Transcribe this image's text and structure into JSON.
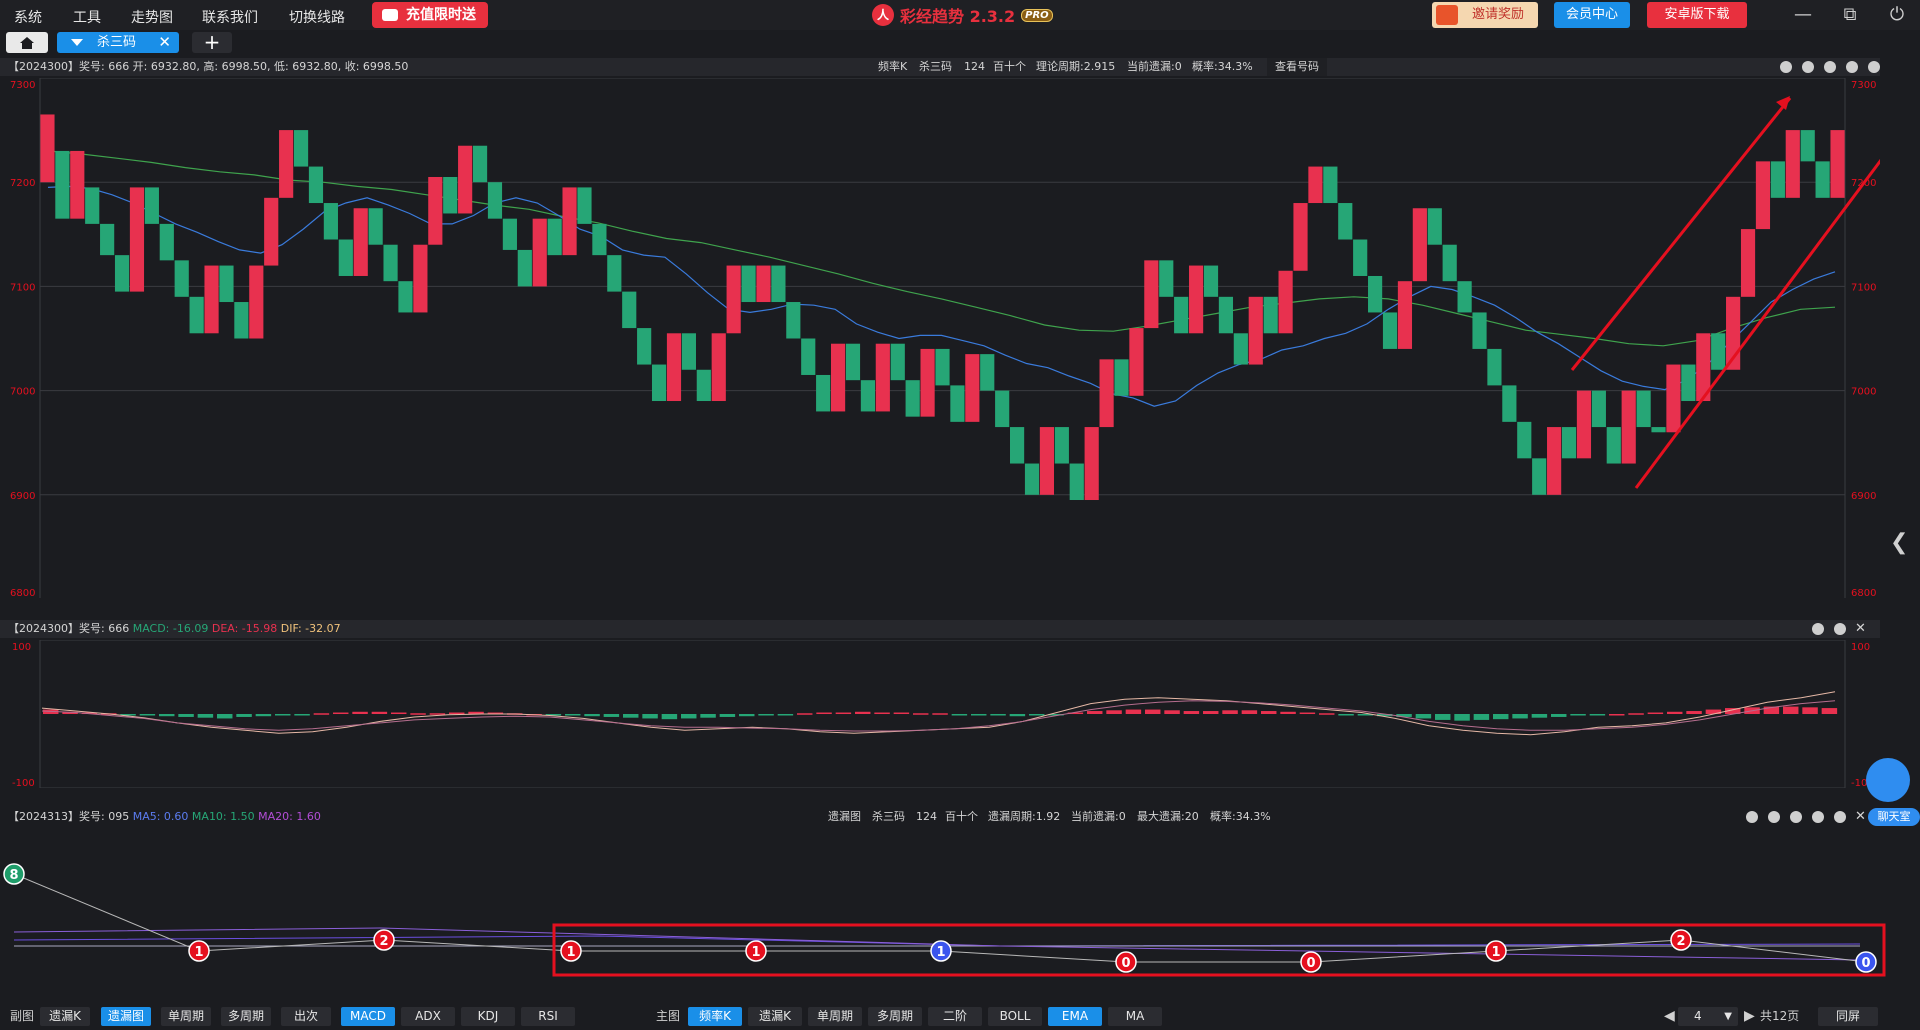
{
  "menu": [
    "系统",
    "工具",
    "走势图",
    "联系我们",
    "切换线路"
  ],
  "promo_label": "充值限时送",
  "app": {
    "logo_glyph": "人",
    "name": "彩经趋势 2.3.2",
    "badge": "PRO"
  },
  "top_buttons": {
    "invite": "邀请奖励",
    "member": "会员中心",
    "android": "安卓版下载"
  },
  "window_controls": {
    "minimize": "—",
    "restore": "⧉",
    "power": "⏻"
  },
  "tabs": {
    "active": "杀三码",
    "add": "+",
    "close": "✕"
  },
  "main_panel": {
    "info": "【2024300】奖号: 666  开: 6932.80, 高: 6998.50, 低: 6932.80, 收: 6998.50",
    "stats": [
      "频率K",
      "杀三码",
      "124",
      "百十个",
      "理论周期:2.915",
      "当前遗漏:0",
      "概率:34.3%"
    ],
    "link": "查看号码",
    "y_ticks": [
      "7300",
      "7200",
      "7100",
      "7000",
      "6900",
      "6800"
    ]
  },
  "macd_panel": {
    "prefix": "【2024300】奖号: 666",
    "macd": "MACD: -16.09",
    "dea": "DEA: -15.98",
    "dif": "DIF: -32.07",
    "y_ticks": [
      "100",
      "-100"
    ]
  },
  "miss_panel": {
    "prefix": "【2024313】奖号: 095",
    "ma5": "MA5: 0.60",
    "ma10": "MA10: 1.50",
    "ma20": "MA20: 1.60",
    "stats": [
      "遗漏图",
      "杀三码",
      "124",
      "百十个",
      "遗漏周期:1.92",
      "当前遗漏:0",
      "最大遗漏:20",
      "概率:34.3%"
    ]
  },
  "miss_points": [
    {
      "v": 8,
      "color": "#1f9d6a"
    },
    {
      "v": 1,
      "color": "#e5101f"
    },
    {
      "v": 2,
      "color": "#e5101f"
    },
    {
      "v": 1,
      "color": "#e5101f"
    },
    {
      "v": 1,
      "color": "#e5101f"
    },
    {
      "v": 1,
      "color": "#3b55ee"
    },
    {
      "v": 0,
      "color": "#e5101f"
    },
    {
      "v": 0,
      "color": "#e5101f"
    },
    {
      "v": 1,
      "color": "#e5101f"
    },
    {
      "v": 2,
      "color": "#e5101f"
    },
    {
      "v": 0,
      "color": "#3b55ee"
    }
  ],
  "bottom": {
    "sub_label": "副图",
    "sub_buttons": [
      "遗漏K",
      "遗漏图",
      "单周期",
      "多周期",
      "出次",
      "MACD",
      "ADX",
      "KDJ",
      "RSI"
    ],
    "main_label": "主图",
    "main_buttons": [
      "频率K",
      "遗漏K",
      "单周期",
      "多周期",
      "二阶",
      "BOLL",
      "EMA",
      "MA"
    ],
    "page_value": "4",
    "page_total": "共12页",
    "same_screen": "同屏"
  },
  "chat_label": "聊天室",
  "colors": {
    "up": "#e8314f",
    "down": "#26a676",
    "accent": "#1a8fe8",
    "ema_fast": "#3a7bdc",
    "ema_slow": "#3fa34d"
  },
  "chart_data": {
    "type": "candlestick",
    "ylim": [
      6800,
      7300
    ],
    "ohlc": [
      [
        7200,
        7265,
        7200,
        7265
      ],
      [
        7230,
        7230,
        7165,
        7165
      ],
      [
        7165,
        7230,
        7165,
        7230
      ],
      [
        7195,
        7195,
        7160,
        7160
      ],
      [
        7160,
        7160,
        7130,
        7130
      ],
      [
        7130,
        7130,
        7095,
        7095
      ],
      [
        7095,
        7195,
        7095,
        7195
      ],
      [
        7195,
        7195,
        7160,
        7160
      ],
      [
        7160,
        7160,
        7125,
        7125
      ],
      [
        7125,
        7125,
        7090,
        7090
      ],
      [
        7090,
        7090,
        7055,
        7055
      ],
      [
        7055,
        7120,
        7055,
        7120
      ],
      [
        7120,
        7120,
        7085,
        7085
      ],
      [
        7085,
        7085,
        7050,
        7050
      ],
      [
        7050,
        7120,
        7050,
        7120
      ],
      [
        7120,
        7185,
        7120,
        7185
      ],
      [
        7185,
        7250,
        7185,
        7250
      ],
      [
        7250,
        7250,
        7215,
        7215
      ],
      [
        7215,
        7215,
        7180,
        7180
      ],
      [
        7180,
        7180,
        7145,
        7145
      ],
      [
        7145,
        7145,
        7110,
        7110
      ],
      [
        7110,
        7175,
        7110,
        7175
      ],
      [
        7175,
        7175,
        7140,
        7140
      ],
      [
        7140,
        7140,
        7105,
        7105
      ],
      [
        7105,
        7105,
        7075,
        7075
      ],
      [
        7075,
        7140,
        7075,
        7140
      ],
      [
        7140,
        7205,
        7140,
        7205
      ],
      [
        7205,
        7205,
        7170,
        7170
      ],
      [
        7170,
        7235,
        7170,
        7235
      ],
      [
        7235,
        7235,
        7200,
        7200
      ],
      [
        7200,
        7200,
        7165,
        7165
      ],
      [
        7165,
        7165,
        7135,
        7135
      ],
      [
        7135,
        7135,
        7100,
        7100
      ],
      [
        7100,
        7165,
        7100,
        7165
      ],
      [
        7165,
        7165,
        7130,
        7130
      ],
      [
        7130,
        7195,
        7130,
        7195
      ],
      [
        7195,
        7195,
        7160,
        7160
      ],
      [
        7160,
        7160,
        7130,
        7130
      ],
      [
        7130,
        7130,
        7095,
        7095
      ],
      [
        7095,
        7095,
        7060,
        7060
      ],
      [
        7060,
        7060,
        7025,
        7025
      ],
      [
        7025,
        7025,
        6990,
        6990
      ],
      [
        6990,
        7055,
        6990,
        7055
      ],
      [
        7055,
        7055,
        7020,
        7020
      ],
      [
        7020,
        7020,
        6990,
        6990
      ],
      [
        6990,
        7055,
        6990,
        7055
      ],
      [
        7055,
        7120,
        7055,
        7120
      ],
      [
        7120,
        7120,
        7085,
        7085
      ],
      [
        7085,
        7120,
        7085,
        7120
      ],
      [
        7120,
        7120,
        7085,
        7085
      ],
      [
        7085,
        7085,
        7050,
        7050
      ],
      [
        7050,
        7050,
        7015,
        7015
      ],
      [
        7015,
        7015,
        6980,
        6980
      ],
      [
        6980,
        7045,
        6980,
        7045
      ],
      [
        7045,
        7045,
        7010,
        7010
      ],
      [
        7010,
        7010,
        6980,
        6980
      ],
      [
        6980,
        7045,
        6980,
        7045
      ],
      [
        7045,
        7045,
        7010,
        7010
      ],
      [
        7010,
        7010,
        6975,
        6975
      ],
      [
        6975,
        7040,
        6975,
        7040
      ],
      [
        7040,
        7040,
        7005,
        7005
      ],
      [
        7005,
        7005,
        6970,
        6970
      ],
      [
        6970,
        7035,
        6970,
        7035
      ],
      [
        7035,
        7035,
        7000,
        7000
      ],
      [
        7000,
        7000,
        6965,
        6965
      ],
      [
        6965,
        6965,
        6930,
        6930
      ],
      [
        6930,
        6930,
        6900,
        6900
      ],
      [
        6900,
        6965,
        6900,
        6965
      ],
      [
        6965,
        6965,
        6930,
        6930
      ],
      [
        6930,
        6930,
        6895,
        6895
      ],
      [
        6895,
        6965,
        6895,
        6965
      ],
      [
        6965,
        7030,
        6965,
        7030
      ],
      [
        7030,
        7030,
        6995,
        6995
      ],
      [
        6995,
        7060,
        6995,
        7060
      ],
      [
        7060,
        7125,
        7060,
        7125
      ],
      [
        7125,
        7125,
        7090,
        7090
      ],
      [
        7090,
        7090,
        7055,
        7055
      ],
      [
        7055,
        7120,
        7055,
        7120
      ],
      [
        7120,
        7120,
        7090,
        7090
      ],
      [
        7090,
        7090,
        7055,
        7055
      ],
      [
        7055,
        7055,
        7025,
        7025
      ],
      [
        7025,
        7090,
        7025,
        7090
      ],
      [
        7090,
        7090,
        7055,
        7055
      ],
      [
        7055,
        7115,
        7055,
        7115
      ],
      [
        7115,
        7180,
        7115,
        7180
      ],
      [
        7180,
        7215,
        7180,
        7215
      ],
      [
        7215,
        7215,
        7180,
        7180
      ],
      [
        7180,
        7180,
        7145,
        7145
      ],
      [
        7145,
        7145,
        7110,
        7110
      ],
      [
        7110,
        7110,
        7075,
        7075
      ],
      [
        7075,
        7075,
        7040,
        7040
      ],
      [
        7040,
        7105,
        7040,
        7105
      ],
      [
        7105,
        7175,
        7105,
        7175
      ],
      [
        7175,
        7175,
        7140,
        7140
      ],
      [
        7140,
        7140,
        7105,
        7105
      ],
      [
        7105,
        7105,
        7075,
        7075
      ],
      [
        7075,
        7075,
        7040,
        7040
      ],
      [
        7040,
        7040,
        7005,
        7005
      ],
      [
        7005,
        7005,
        6970,
        6970
      ],
      [
        6970,
        6970,
        6935,
        6935
      ],
      [
        6935,
        6935,
        6900,
        6900
      ],
      [
        6900,
        6965,
        6900,
        6965
      ],
      [
        6965,
        6965,
        6935,
        6935
      ],
      [
        6935,
        7000,
        6935,
        7000
      ],
      [
        7000,
        7000,
        6965,
        6965
      ],
      [
        6965,
        6965,
        6930,
        6930
      ],
      [
        6930,
        7000,
        6930,
        7000
      ],
      [
        7000,
        7000,
        6965,
        6965
      ],
      [
        6965,
        6965,
        6960,
        6960
      ],
      [
        6960,
        7025,
        6960,
        7025
      ],
      [
        7025,
        7025,
        6990,
        6990
      ],
      [
        6990,
        7055,
        6990,
        7055
      ],
      [
        7055,
        7055,
        7020,
        7020
      ],
      [
        7020,
        7090,
        7020,
        7090
      ],
      [
        7090,
        7155,
        7090,
        7155
      ],
      [
        7155,
        7220,
        7155,
        7220
      ],
      [
        7220,
        7220,
        7185,
        7185
      ],
      [
        7185,
        7250,
        7185,
        7250
      ],
      [
        7250,
        7250,
        7220,
        7220
      ],
      [
        7220,
        7220,
        7185,
        7185
      ],
      [
        7185,
        7250,
        7185,
        7250
      ]
    ],
    "ema_fast": [
      7195,
      7196,
      7194,
      7188,
      7180,
      7170,
      7160,
      7152,
      7143,
      7135,
      7132,
      7140,
      7155,
      7172,
      7180,
      7185,
      7178,
      7170,
      7160,
      7160,
      7168,
      7180,
      7185,
      7180,
      7168,
      7155,
      7148,
      7135,
      7130,
      7128,
      7112,
      7094,
      7078,
      7075,
      7078,
      7083,
      7082,
      7078,
      7064,
      7056,
      7050,
      7053,
      7053,
      7048,
      7043,
      7034,
      7026,
      7022,
      7014,
      7007,
      6997,
      6993,
      6985,
      6990,
      7005,
      7017,
      7025,
      7030,
      7039,
      7043,
      7050,
      7055,
      7064,
      7078,
      7090,
      7100,
      7097,
      7090,
      7082,
      7070,
      7056,
      7045,
      7032,
      7019,
      7009,
      7004,
      7001,
      7010,
      7025,
      7045,
      7065,
      7085,
      7097,
      7107,
      7114
    ],
    "ema_slow": [
      7230,
      7227,
      7223,
      7219,
      7214,
      7210,
      7207,
      7202,
      7200,
      7196,
      7193,
      7188,
      7183,
      7178,
      7174,
      7167,
      7161,
      7153,
      7146,
      7142,
      7135,
      7128,
      7120,
      7112,
      7103,
      7095,
      7088,
      7080,
      7072,
      7063,
      7058,
      7057,
      7062,
      7068,
      7074,
      7080,
      7084,
      7088,
      7090,
      7088,
      7082,
      7074,
      7066,
      7058,
      7054,
      7050,
      7045,
      7043,
      7048,
      7060,
      7070,
      7078,
      7080
    ],
    "macd_hist": [
      6,
      3,
      2,
      1,
      -1,
      -2,
      -3,
      -4,
      -5,
      -6,
      -4,
      -3,
      -2,
      -1,
      1,
      2,
      3,
      3,
      2,
      1,
      1,
      2,
      3,
      2,
      1,
      0,
      -1,
      -2,
      -3,
      -4,
      -5,
      -6,
      -7,
      -6,
      -5,
      -4,
      -3,
      -2,
      -1,
      1,
      2,
      2,
      3,
      2,
      2,
      1,
      1,
      -1,
      -1,
      -2,
      -3,
      -2,
      -1,
      2,
      4,
      5,
      6,
      6,
      5,
      4,
      4,
      5,
      5,
      4,
      3,
      2,
      1,
      -1,
      -2,
      -3,
      -4,
      -6,
      -8,
      -9,
      -8,
      -7,
      -6,
      -5,
      -4,
      -2,
      -1,
      0,
      1,
      2,
      3,
      4,
      6,
      8,
      9,
      10,
      10,
      9,
      8
    ],
    "macd_dif": [
      8,
      4,
      0,
      -5,
      -12,
      -18,
      -22,
      -26,
      -24,
      -18,
      -10,
      -4,
      -1,
      0,
      0,
      -2,
      -6,
      -12,
      -18,
      -22,
      -20,
      -18,
      -20,
      -24,
      -26,
      -24,
      -22,
      -20,
      -18,
      -10,
      2,
      14,
      20,
      22,
      20,
      18,
      14,
      10,
      6,
      2,
      -6,
      -16,
      -22,
      -26,
      -28,
      -24,
      -18,
      -16,
      -12,
      -4,
      6,
      16,
      22,
      30
    ],
    "macd_dea": [
      4,
      2,
      -2,
      -6,
      -12,
      -16,
      -20,
      -22,
      -20,
      -16,
      -12,
      -8,
      -6,
      -4,
      -3,
      -4,
      -8,
      -12,
      -16,
      -18,
      -18,
      -19,
      -20,
      -22,
      -23,
      -23,
      -22,
      -20,
      -16,
      -10,
      -2,
      6,
      12,
      16,
      18,
      17,
      15,
      12,
      8,
      4,
      -2,
      -10,
      -16,
      -20,
      -22,
      -22,
      -20,
      -18,
      -14,
      -8,
      0,
      8,
      14,
      18
    ]
  }
}
